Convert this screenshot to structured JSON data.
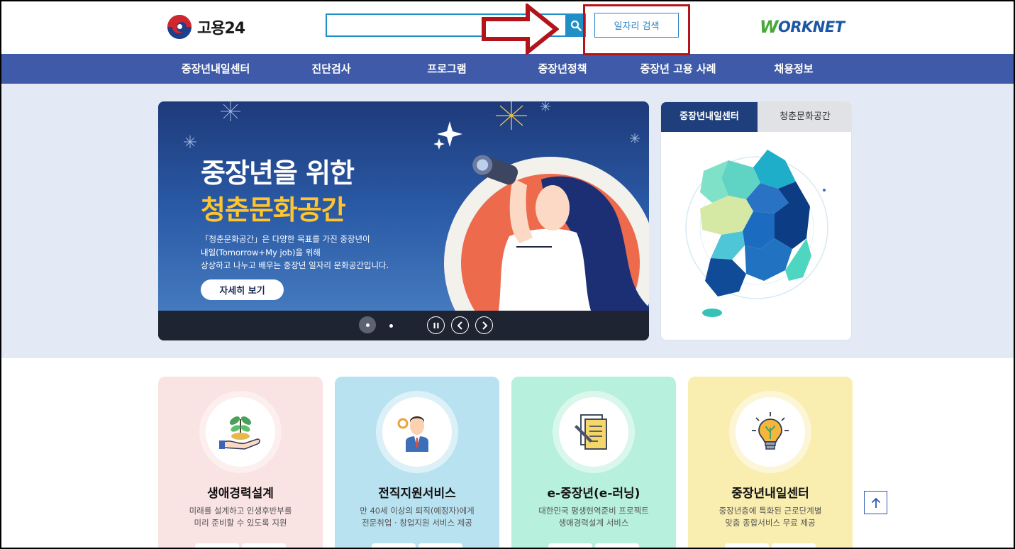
{
  "header": {
    "logo_text": "고용24",
    "search": {
      "value": "",
      "placeholder": ""
    },
    "job_search_label": "일자리 검색",
    "worknet_w": "W",
    "worknet_rest": "ORKNET"
  },
  "nav": {
    "items": [
      {
        "label": "중장년내일센터"
      },
      {
        "label": "진단검사"
      },
      {
        "label": "프로그램"
      },
      {
        "label": "중장년정책"
      },
      {
        "label": "중장년 고용 사례"
      },
      {
        "label": "채용정보"
      }
    ]
  },
  "banner": {
    "title_line1": "중장년을 위한",
    "title_line2": "청춘문화공간",
    "desc_line1": "「청춘문화공간」은 다양한 목표를 가진 중장년이",
    "desc_line2": "내일(Tomorrow+My job)을 위해",
    "desc_line3": "상상하고 나누고 배우는 중장년 일자리 문화공간입니다.",
    "button_label": "자세히 보기",
    "colors": {
      "title_accent": "#ffc52d",
      "bg_top": "#1e3a7a",
      "circle": "#f06a4d"
    }
  },
  "panel": {
    "tabs": [
      {
        "label": "중장년내일센터",
        "active": true
      },
      {
        "label": "청춘문화공간",
        "active": false
      }
    ]
  },
  "cards": [
    {
      "title": "생애경력설계",
      "desc_line1": "미래를 설계하고 인생후반부를",
      "desc_line2": "미리 준비할 수 있도록 지원",
      "bg": "#f9e3e3",
      "icon": "plant-hand-icon"
    },
    {
      "title": "전직지원서비스",
      "desc_line1": "만 40세 이상의 퇴직(예정자)에게",
      "desc_line2": "전문취업 · 창업지원 서비스 제공",
      "bg": "#b9e2f1",
      "icon": "businessman-icon"
    },
    {
      "title": "e-중장년(e-러닝)",
      "desc_line1": "대한민국 평생현역준비 프로젝트",
      "desc_line2": "생애경력설계 서비스",
      "bg": "#b7f0dc",
      "icon": "document-pen-icon"
    },
    {
      "title": "중장년내일센터",
      "desc_line1": "중장년층에 특화된 근로단계별",
      "desc_line2": "맞춤 종합서비스 무료 제공",
      "bg": "#f9eeb0",
      "icon": "lightbulb-icon"
    }
  ]
}
